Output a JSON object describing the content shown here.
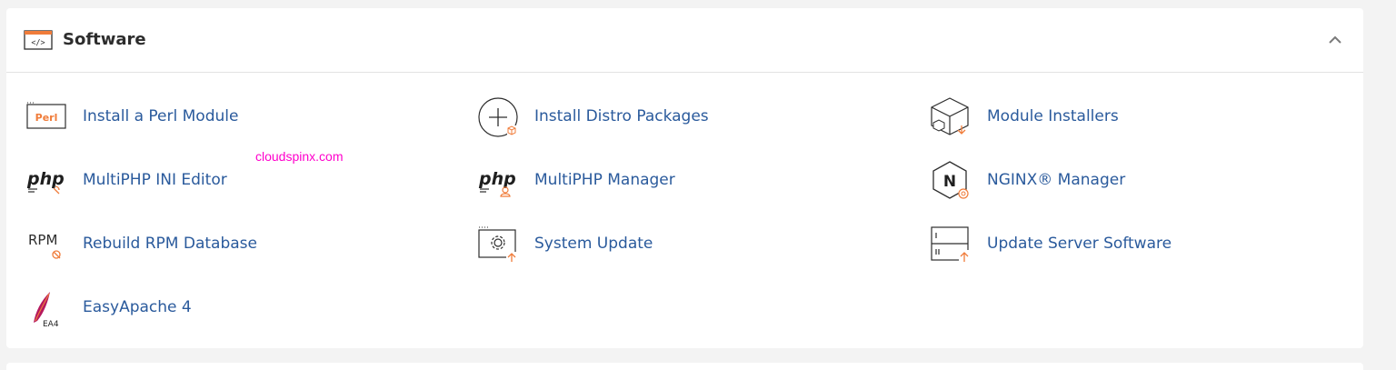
{
  "section": {
    "title": "Software",
    "header_icon": "code-window-icon",
    "collapse_icon": "chevron-up-icon"
  },
  "watermark": "cloudspinx.com",
  "icon_text": {
    "perl": "Perl",
    "php": "php",
    "rpm": "RPM",
    "ea4": "EA4",
    "nginx": "N"
  },
  "items": [
    {
      "label": "Install a Perl Module",
      "icon": "perl-module-icon"
    },
    {
      "label": "Install Distro Packages",
      "icon": "add-package-icon"
    },
    {
      "label": "Module Installers",
      "icon": "module-box-icon"
    },
    {
      "label": "MultiPHP INI Editor",
      "icon": "php-ini-editor-icon"
    },
    {
      "label": "MultiPHP Manager",
      "icon": "php-manager-icon"
    },
    {
      "label": "NGINX® Manager",
      "icon": "nginx-icon"
    },
    {
      "label": "Rebuild RPM Database",
      "icon": "rpm-icon"
    },
    {
      "label": "System Update",
      "icon": "system-update-icon"
    },
    {
      "label": "Update Server Software",
      "icon": "server-update-icon"
    },
    {
      "label": "EasyApache 4",
      "icon": "easyapache-feather-icon"
    }
  ],
  "colors": {
    "link": "#2a5a9c",
    "accent": "#f07c3a",
    "icon": "#2d2d2d",
    "watermark": "#ff00cc"
  }
}
